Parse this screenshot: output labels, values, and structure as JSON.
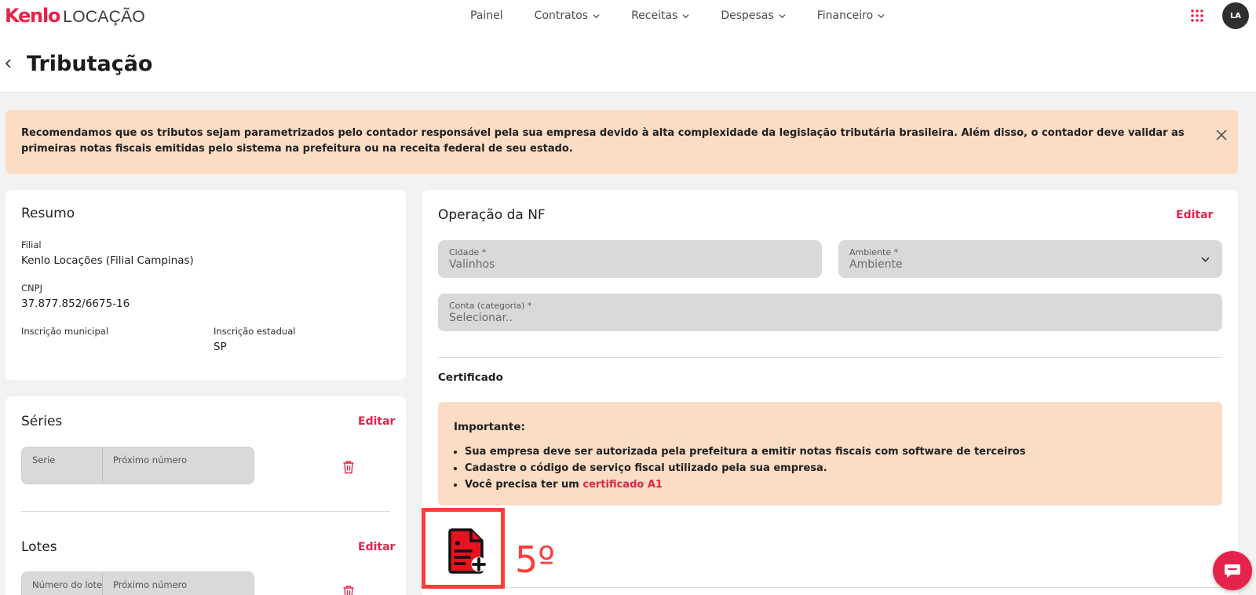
{
  "brand": {
    "logo_main": "Kenlo",
    "logo_product": "LOCAÇÃO"
  },
  "nav": {
    "items": [
      {
        "label": "Painel",
        "has_dropdown": false
      },
      {
        "label": "Contratos",
        "has_dropdown": true
      },
      {
        "label": "Receitas",
        "has_dropdown": true
      },
      {
        "label": "Despesas",
        "has_dropdown": true
      },
      {
        "label": "Financeiro",
        "has_dropdown": true
      }
    ],
    "avatar_initials": "LA"
  },
  "page": {
    "title": "Tributação"
  },
  "alert": {
    "text": "Recomendamos que os tributos sejam parametrizados pelo contador responsável pela sua empresa devido à alta complexidade da legislação tributária brasileira. Além disso, o contador deve validar as primeiras notas fiscais emitidas pelo sistema na prefeitura ou na receita federal de seu estado."
  },
  "resumo": {
    "title": "Resumo",
    "filial_label": "Filial",
    "filial_value": "Kenlo Locações (Filial Campinas)",
    "cnpj_label": "CNPJ",
    "cnpj_value": "37.877.852/6675-16",
    "inscricao_municipal_label": "Inscrição municipal",
    "inscricao_estadual_label": "Inscrição estadual",
    "inscricao_estadual_value": "SP"
  },
  "series": {
    "title": "Séries",
    "edit_label": "Editar",
    "col_serie": "Serie",
    "col_proximo": "Próximo número"
  },
  "lotes": {
    "title": "Lotes",
    "edit_label": "Editar",
    "col_lote": "Número do lote",
    "col_proximo": "Próximo número"
  },
  "operacao": {
    "title": "Operação da NF",
    "edit_label": "Editar",
    "cidade_label": "Cidade *",
    "cidade_value": "Valinhos",
    "ambiente_label": "Ambiente *",
    "ambiente_placeholder": "Ambiente",
    "conta_label": "Conta (categoria) *",
    "conta_placeholder": "Selecionar..",
    "certificado_label": "Certificado",
    "important_title": "Importante:",
    "important_items": [
      "Sua empresa deve ser autorizada pela prefeitura a emitir notas fiscais com software de terceiros",
      "Cadastre o código de serviço fiscal utilizado pela sua empresa."
    ],
    "important_item3_prefix": "Você precisa ter um ",
    "important_item3_link": "certificado A1"
  },
  "annotation": {
    "step_label": "5º"
  },
  "colors": {
    "brand": "#e5234a",
    "alert_bg": "#fbdcc4",
    "highlight": "#ff3b3b",
    "field_bg": "#d9d9d9"
  }
}
